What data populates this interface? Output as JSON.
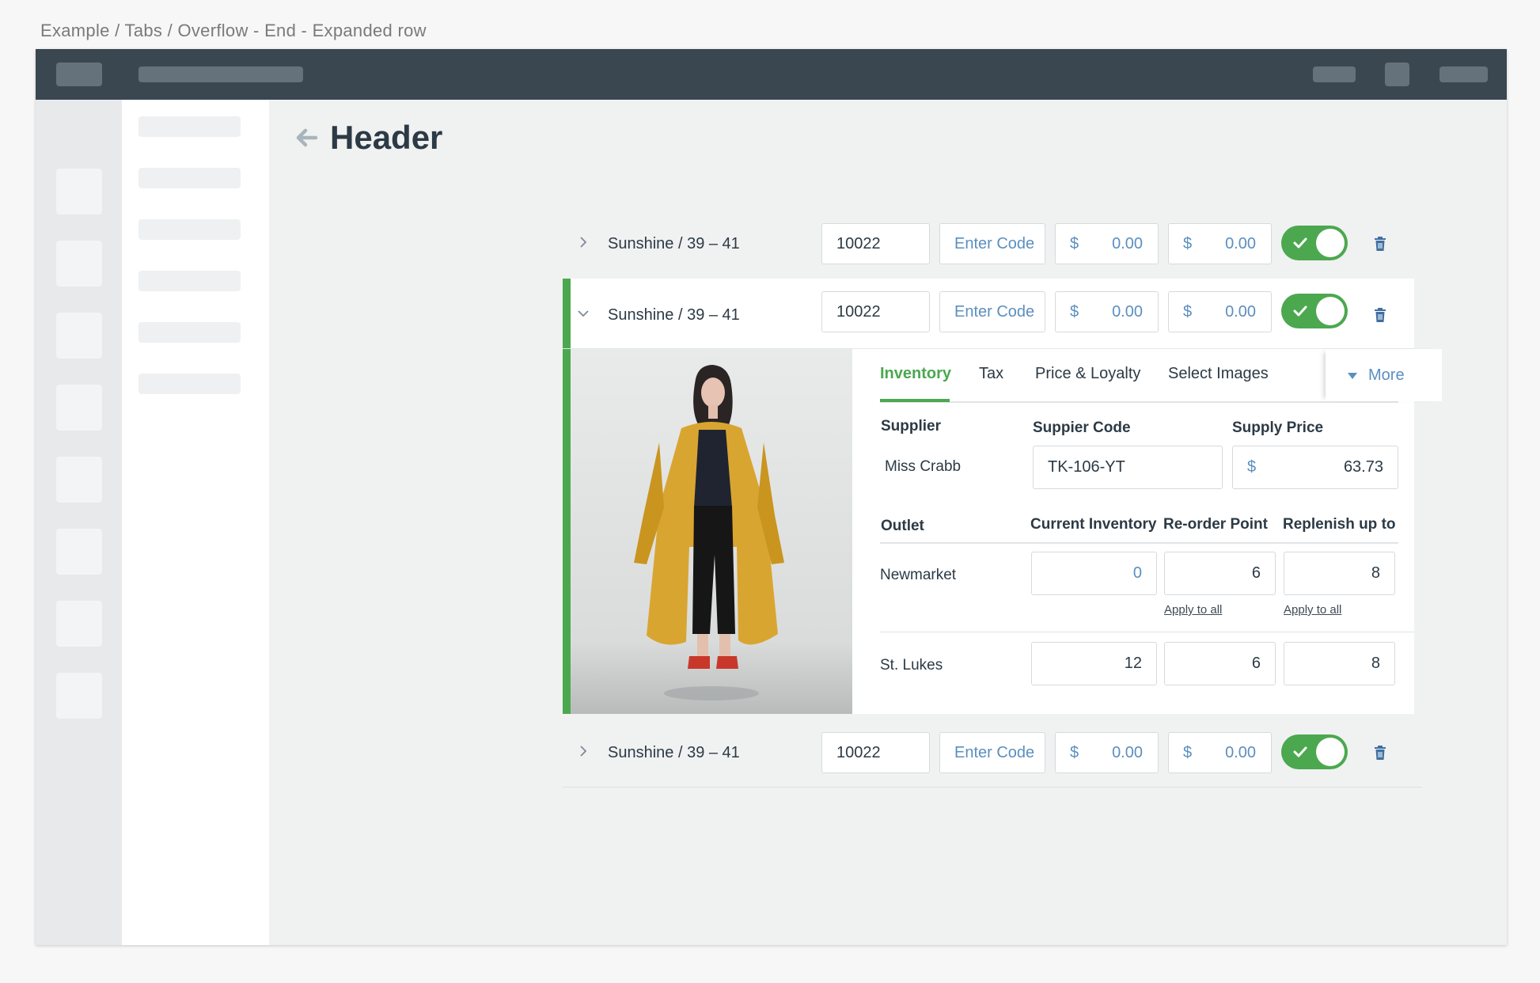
{
  "breadcrumb": "Example / Tabs / Overflow - End - Expanded row",
  "page": {
    "title": "Header"
  },
  "rows": [
    {
      "name": "Sunshine / 39 – 41",
      "code": "10022",
      "enter_code_placeholder": "Enter Code",
      "currency": "$",
      "price1": "0.00",
      "price2": "0.00",
      "enabled": true,
      "expanded": false
    },
    {
      "name": "Sunshine / 39 – 41",
      "code": "10022",
      "enter_code_placeholder": "Enter Code",
      "currency": "$",
      "price1": "0.00",
      "price2": "0.00",
      "enabled": true,
      "expanded": true
    },
    {
      "name": "Sunshine / 39 – 41",
      "code": "10022",
      "enter_code_placeholder": "Enter Code",
      "currency": "$",
      "price1": "0.00",
      "price2": "0.00",
      "enabled": true,
      "expanded": false
    }
  ],
  "detail": {
    "tabs": [
      "Inventory",
      "Tax",
      "Price & Loyalty",
      "Select Images"
    ],
    "active_tab": "Inventory",
    "more_label": "More",
    "supplier_header": "Supplier",
    "supplier_code_header": "Suppier Code",
    "supply_price_header": "Supply Price",
    "supplier": "Miss Crabb",
    "supplier_code": "TK-106-YT",
    "supply_price_currency": "$",
    "supply_price": "63.73",
    "outlet_header": "Outlet",
    "current_inventory_header": "Current Inventory",
    "reorder_point_header": "Re-order Point",
    "replenish_header": "Replenish up to",
    "apply_to_all": "Apply to all",
    "outlets": [
      {
        "name": "Newmarket",
        "current_inventory": "0",
        "reorder_point": "6",
        "replenish": "8"
      },
      {
        "name": "St. Lukes",
        "current_inventory": "12",
        "reorder_point": "6",
        "replenish": "8"
      }
    ]
  },
  "colors": {
    "accent_green": "#4ba84f",
    "topbar": "#3a4751",
    "link_blue": "#5b8fbf",
    "text": "#2c3a45"
  },
  "icons": [
    "back-arrow-icon",
    "chevron-right-icon",
    "chevron-down-icon",
    "check-icon",
    "trash-icon",
    "caret-down-icon"
  ]
}
